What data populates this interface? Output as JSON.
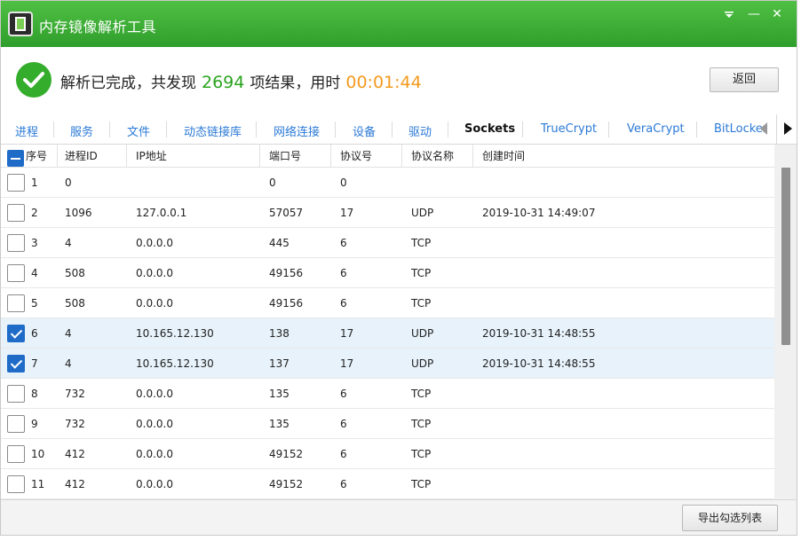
{
  "window": {
    "title": "内存镜像解析工具",
    "menu_icon": "dropdown-arrow-icon",
    "minimize": "—",
    "close": "✕"
  },
  "status": {
    "prefix": "解析已完成，共发现",
    "count": "2694",
    "middle": "项结果，用时",
    "elapsed": "00:01:44",
    "back_label": "返回",
    "colors": {
      "success": "#35ad2c",
      "count": "#2aa41e",
      "elapsed": "#f39a1e"
    }
  },
  "tabs": [
    {
      "label": "进程"
    },
    {
      "label": "服务"
    },
    {
      "label": "文件"
    },
    {
      "label": "动态链接库"
    },
    {
      "label": "网络连接"
    },
    {
      "label": "设备"
    },
    {
      "label": "驱动"
    },
    {
      "label": "Sockets",
      "active": true
    },
    {
      "label": "TrueCrypt"
    },
    {
      "label": "VeraCrypt"
    },
    {
      "label": "BitLocker"
    }
  ],
  "table": {
    "columns": [
      "序号",
      "进程ID",
      "IP地址",
      "端口号",
      "协议号",
      "协议名称",
      "创建时间"
    ],
    "rows": [
      {
        "checked": false,
        "cells": [
          "1",
          "0",
          "",
          "0",
          "0",
          "",
          ""
        ]
      },
      {
        "checked": false,
        "cells": [
          "2",
          "1096",
          "127.0.0.1",
          "57057",
          "17",
          "UDP",
          "2019-10-31 14:49:07"
        ]
      },
      {
        "checked": false,
        "cells": [
          "3",
          "4",
          "0.0.0.0",
          "445",
          "6",
          "TCP",
          ""
        ]
      },
      {
        "checked": false,
        "cells": [
          "4",
          "508",
          "0.0.0.0",
          "49156",
          "6",
          "TCP",
          ""
        ]
      },
      {
        "checked": false,
        "cells": [
          "5",
          "508",
          "0.0.0.0",
          "49156",
          "6",
          "TCP",
          ""
        ]
      },
      {
        "checked": true,
        "cells": [
          "6",
          "4",
          "10.165.12.130",
          "138",
          "17",
          "UDP",
          "2019-10-31 14:48:55"
        ]
      },
      {
        "checked": true,
        "cells": [
          "7",
          "4",
          "10.165.12.130",
          "137",
          "17",
          "UDP",
          "2019-10-31 14:48:55"
        ]
      },
      {
        "checked": false,
        "cells": [
          "8",
          "732",
          "0.0.0.0",
          "135",
          "6",
          "TCP",
          ""
        ]
      },
      {
        "checked": false,
        "cells": [
          "9",
          "732",
          "0.0.0.0",
          "135",
          "6",
          "TCP",
          ""
        ]
      },
      {
        "checked": false,
        "cells": [
          "10",
          "412",
          "0.0.0.0",
          "49152",
          "6",
          "TCP",
          ""
        ]
      },
      {
        "checked": false,
        "cells": [
          "11",
          "412",
          "0.0.0.0",
          "49152",
          "6",
          "TCP",
          ""
        ]
      }
    ]
  },
  "footer": {
    "export_label": "导出勾选列表"
  }
}
